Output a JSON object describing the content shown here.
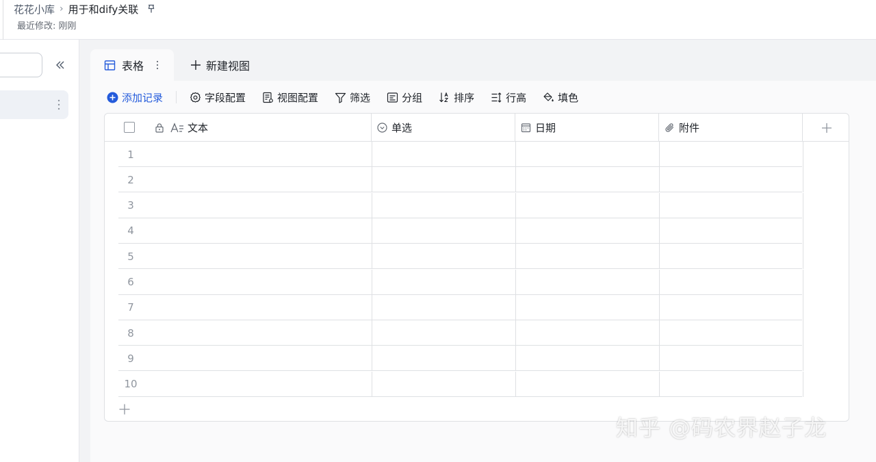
{
  "header": {
    "breadcrumb_root": "花花小库",
    "breadcrumb_current": "用于和dify关联",
    "last_modified": "最近修改: 刚刚"
  },
  "tabs": {
    "active_label": "表格",
    "new_view_label": "新建视图"
  },
  "toolbar": {
    "add_record": "添加记录",
    "field_config": "字段配置",
    "view_config": "视图配置",
    "filter": "筛选",
    "group": "分组",
    "sort": "排序",
    "row_height": "行高",
    "fill_color": "填色"
  },
  "table": {
    "columns": [
      {
        "label": "文本",
        "icon": "text-icon"
      },
      {
        "label": "单选",
        "icon": "single-select-icon"
      },
      {
        "label": "日期",
        "icon": "calendar-icon"
      },
      {
        "label": "附件",
        "icon": "paperclip-icon"
      }
    ],
    "rows": [
      "1",
      "2",
      "3",
      "4",
      "5",
      "6",
      "7",
      "8",
      "9",
      "10"
    ]
  },
  "watermark": "知乎 @码农界赵子龙",
  "colors": {
    "accent": "#245bdb",
    "border": "#dee0e3",
    "background": "#f2f3f5"
  }
}
